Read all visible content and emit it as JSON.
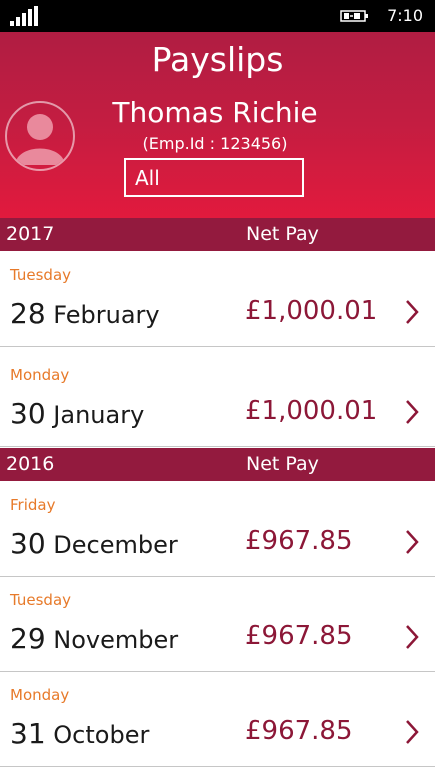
{
  "status_bar": {
    "time": "7:10",
    "signal_icon": "signal-bars-icon",
    "battery_icon": "battery-charging-icon"
  },
  "header": {
    "title": "Payslips",
    "employee_name": "Thomas Richie",
    "employee_id": "(Emp.Id : 123456)",
    "filter_value": "All",
    "avatar_icon": "user-avatar-icon"
  },
  "colors": {
    "header_gradient_top": "#b01d42",
    "header_gradient_bottom": "#e21a3d",
    "year_bar": "#931a3e",
    "amount_text": "#8c1737",
    "weekday_text": "#e77a2a"
  },
  "groups": [
    {
      "year": "2017",
      "net_pay_label": "Net Pay",
      "payslips": [
        {
          "weekday": "Tuesday",
          "day": "28",
          "month": "February",
          "amount": "£1,000.01"
        },
        {
          "weekday": "Monday",
          "day": "30",
          "month": "January",
          "amount": "£1,000.01"
        }
      ]
    },
    {
      "year": "2016",
      "net_pay_label": "Net Pay",
      "payslips": [
        {
          "weekday": "Friday",
          "day": "30",
          "month": "December",
          "amount": "£967.85"
        },
        {
          "weekday": "Tuesday",
          "day": "29",
          "month": "November",
          "amount": "£967.85"
        },
        {
          "weekday": "Monday",
          "day": "31",
          "month": "October",
          "amount": "£967.85"
        }
      ]
    }
  ]
}
